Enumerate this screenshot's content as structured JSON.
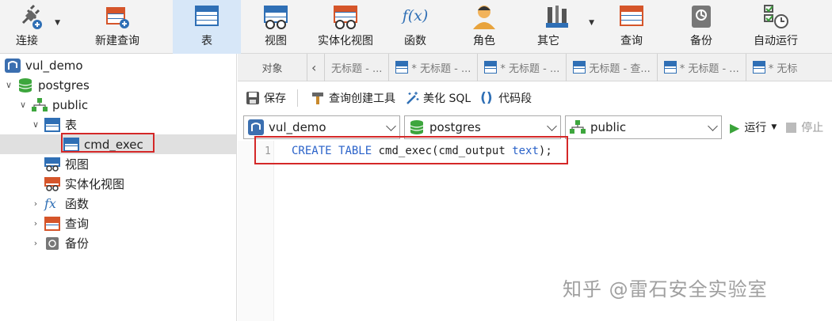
{
  "toolbar": {
    "items": [
      {
        "label": "连接",
        "icon": "plug-icon",
        "dropdown": true
      },
      {
        "label": "新建查询",
        "icon": "new-query-icon"
      },
      {
        "label": "表",
        "icon": "table-icon",
        "active": true
      },
      {
        "label": "视图",
        "icon": "view-icon"
      },
      {
        "label": "实体化视图",
        "icon": "materialized-view-icon"
      },
      {
        "label": "函数",
        "icon": "function-icon",
        "glyph": "f(x)"
      },
      {
        "label": "角色",
        "icon": "user-icon"
      },
      {
        "label": "其它",
        "icon": "tools-icon",
        "dropdown": true
      },
      {
        "label": "查询",
        "icon": "query-icon"
      },
      {
        "label": "备份",
        "icon": "backup-icon"
      },
      {
        "label": "自动运行",
        "icon": "schedule-icon"
      }
    ]
  },
  "sidebar": {
    "connection": "vul_demo",
    "database": "postgres",
    "schema": "public",
    "tables_group": "表",
    "selected_table": "cmd_exec",
    "views": "视图",
    "materialized_views": "实体化视图",
    "functions": "函数",
    "functions_glyph": "fx",
    "queries": "查询",
    "backups": "备份"
  },
  "tabs": {
    "objects": "对象",
    "items": [
      "无标题 - ...",
      "* 无标题 - ...",
      "* 无标题 - ...",
      "无标题 - 查...",
      "* 无标题 - ...",
      "* 无标"
    ]
  },
  "subtoolbar": {
    "save": "保存",
    "query_builder": "查询创建工具",
    "beautify": "美化 SQL",
    "snippet": "代码段",
    "snippet_glyph": "()"
  },
  "selectors": {
    "connection": "vul_demo",
    "database": "postgres",
    "schema": "public",
    "run": "运行",
    "stop": "停止"
  },
  "editor": {
    "line_number": "1",
    "kw1": "CREATE",
    "kw2": "TABLE",
    "ident": "cmd_exec(cmd_output",
    "kw3": "text",
    "tail": ");"
  },
  "watermark": "知乎 @雷石安全实验室",
  "colors": {
    "accent": "#2f6fb5",
    "highlight_box": "#d42828",
    "active_tab": "#d7e7f8"
  }
}
